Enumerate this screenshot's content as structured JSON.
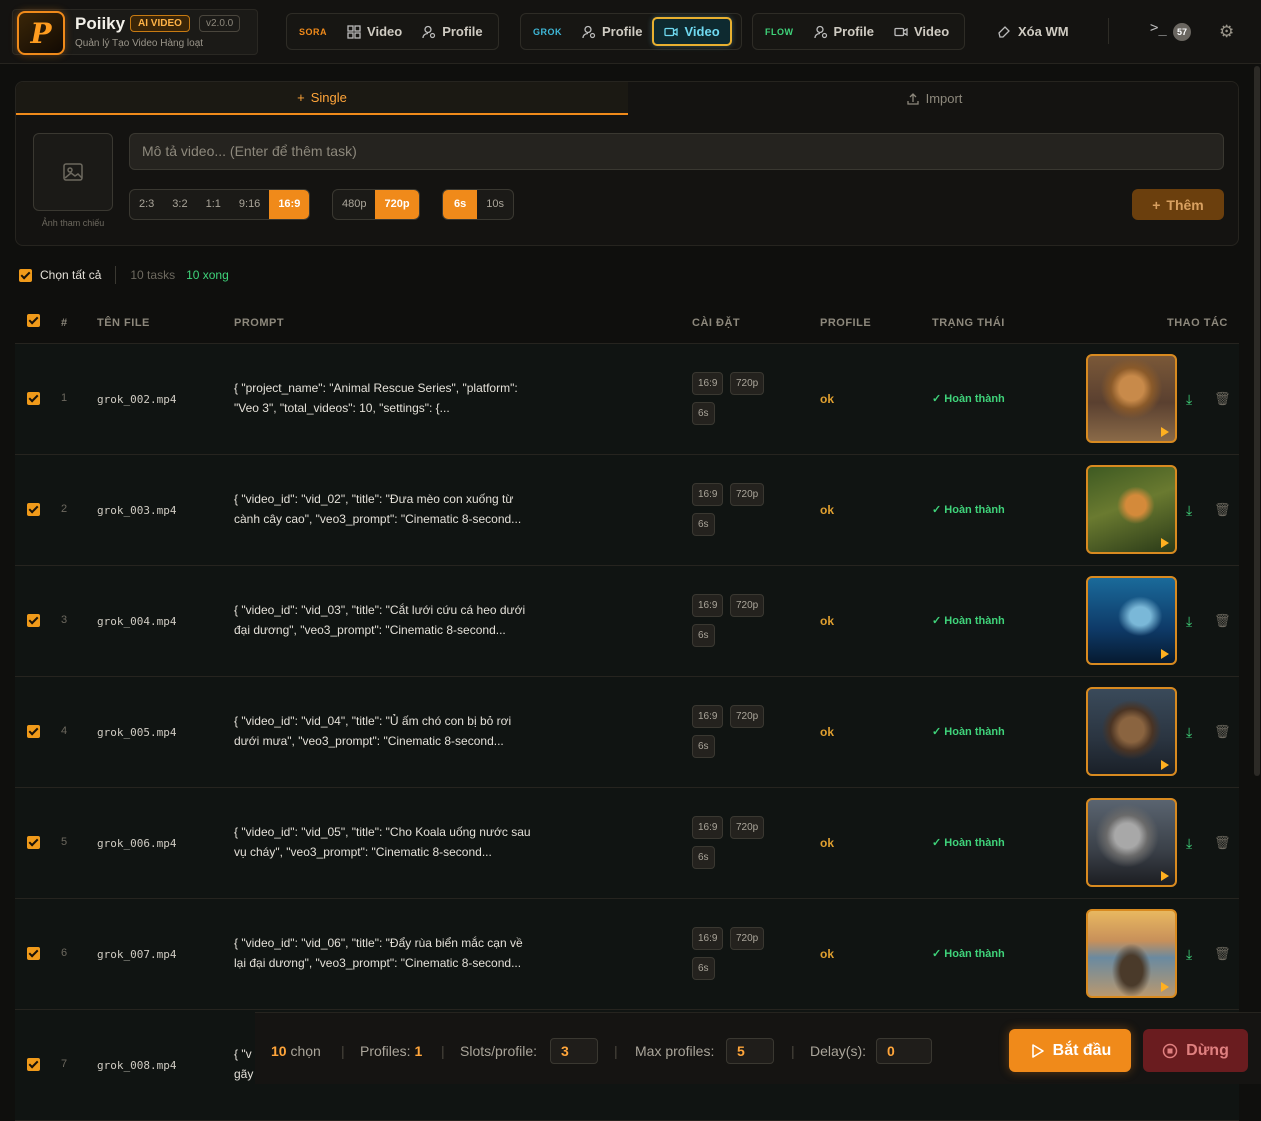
{
  "brand": {
    "name": "Poiiky",
    "badge": "AI VIDEO",
    "version": "v2.0.0",
    "subtitle": "Quản lý Tạo Video Hàng loạt",
    "logo_letter": "P"
  },
  "nav": {
    "sora": {
      "tag": "SORA",
      "video": "Video",
      "profile": "Profile",
      "color": "#f08a1a"
    },
    "grok": {
      "tag": "GROK",
      "profile": "Profile",
      "video": "Video",
      "color": "#3fb8d8"
    },
    "flow": {
      "tag": "FLOW",
      "profile": "Profile",
      "video": "Video",
      "color": "#3fd37a"
    },
    "xoa_wm": "Xóa WM",
    "terminal": ">_",
    "count": "57"
  },
  "panel": {
    "tab_single": "Single",
    "tab_import": "Import",
    "ref_label": "Ảnh tham chiếu",
    "prompt_placeholder": "Mô tả video... (Enter để thêm task)",
    "ratios": [
      "2:3",
      "3:2",
      "1:1",
      "9:16",
      "16:9"
    ],
    "ratio_selected": "16:9",
    "resolutions": [
      "480p",
      "720p"
    ],
    "res_selected": "720p",
    "durations": [
      "6s",
      "10s"
    ],
    "dur_selected": "6s",
    "add_label": "Thêm"
  },
  "selection": {
    "select_all": "Chọn tất cả",
    "tasks": "10 tasks",
    "done": "10 xong"
  },
  "table": {
    "headers": {
      "num": "#",
      "file": "TÊN FILE",
      "prompt": "PROMPT",
      "settings": "CÀI ĐẶT",
      "profile": "PROFILE",
      "status": "TRẠNG THÁI",
      "actions": "THAO TÁC"
    },
    "rows": [
      {
        "num": "1",
        "file": "grok_002.mp4",
        "prompt1": "{ \"project_name\": \"Animal Rescue Series\", \"platform\":",
        "prompt2": "\"Veo 3\", \"total_videos\": 10, \"settings\": {...",
        "ratio": "16:9",
        "res": "720p",
        "dur": "6s",
        "profile": "ok",
        "status": "Hoàn thành"
      },
      {
        "num": "2",
        "file": "grok_003.mp4",
        "prompt1": "{ \"video_id\": \"vid_02\", \"title\": \"Đưa mèo con xuống từ",
        "prompt2": "cành cây cao\", \"veo3_prompt\": \"Cinematic 8-second...",
        "ratio": "16:9",
        "res": "720p",
        "dur": "6s",
        "profile": "ok",
        "status": "Hoàn thành"
      },
      {
        "num": "3",
        "file": "grok_004.mp4",
        "prompt1": "{ \"video_id\": \"vid_03\", \"title\": \"Cắt lưới cứu cá heo dưới",
        "prompt2": "đại dương\", \"veo3_prompt\": \"Cinematic 8-second...",
        "ratio": "16:9",
        "res": "720p",
        "dur": "6s",
        "profile": "ok",
        "status": "Hoàn thành"
      },
      {
        "num": "4",
        "file": "grok_005.mp4",
        "prompt1": "{ \"video_id\": \"vid_04\", \"title\": \"Ủ ấm chó con bị bỏ rơi",
        "prompt2": "dưới mưa\", \"veo3_prompt\": \"Cinematic 8-second...",
        "ratio": "16:9",
        "res": "720p",
        "dur": "6s",
        "profile": "ok",
        "status": "Hoàn thành"
      },
      {
        "num": "5",
        "file": "grok_006.mp4",
        "prompt1": "{ \"video_id\": \"vid_05\", \"title\": \"Cho Koala uống nước sau",
        "prompt2": "vụ cháy\", \"veo3_prompt\": \"Cinematic 8-second...",
        "ratio": "16:9",
        "res": "720p",
        "dur": "6s",
        "profile": "ok",
        "status": "Hoàn thành"
      },
      {
        "num": "6",
        "file": "grok_007.mp4",
        "prompt1": "{ \"video_id\": \"vid_06\", \"title\": \"Đẩy rùa biển mắc cạn về",
        "prompt2": "lại đại dương\", \"veo3_prompt\": \"Cinematic 8-second...",
        "ratio": "16:9",
        "res": "720p",
        "dur": "6s",
        "profile": "ok",
        "status": "Hoàn thành"
      },
      {
        "num": "7",
        "file": "grok_008.mp4",
        "prompt1": "{ \"v",
        "prompt2": "gãy",
        "ratio": "",
        "res": "",
        "dur": "",
        "profile": "",
        "status": ""
      }
    ]
  },
  "footer": {
    "selected_count": "10",
    "selected_label": "chọn",
    "profiles_label": "Profiles:",
    "profiles_value": "1",
    "slots_label": "Slots/profile:",
    "slots_value": "3",
    "max_label": "Max profiles:",
    "max_value": "5",
    "delay_label": "Delay(s):",
    "delay_value": "0",
    "start": "Bắt đầu",
    "stop": "Dừng"
  }
}
